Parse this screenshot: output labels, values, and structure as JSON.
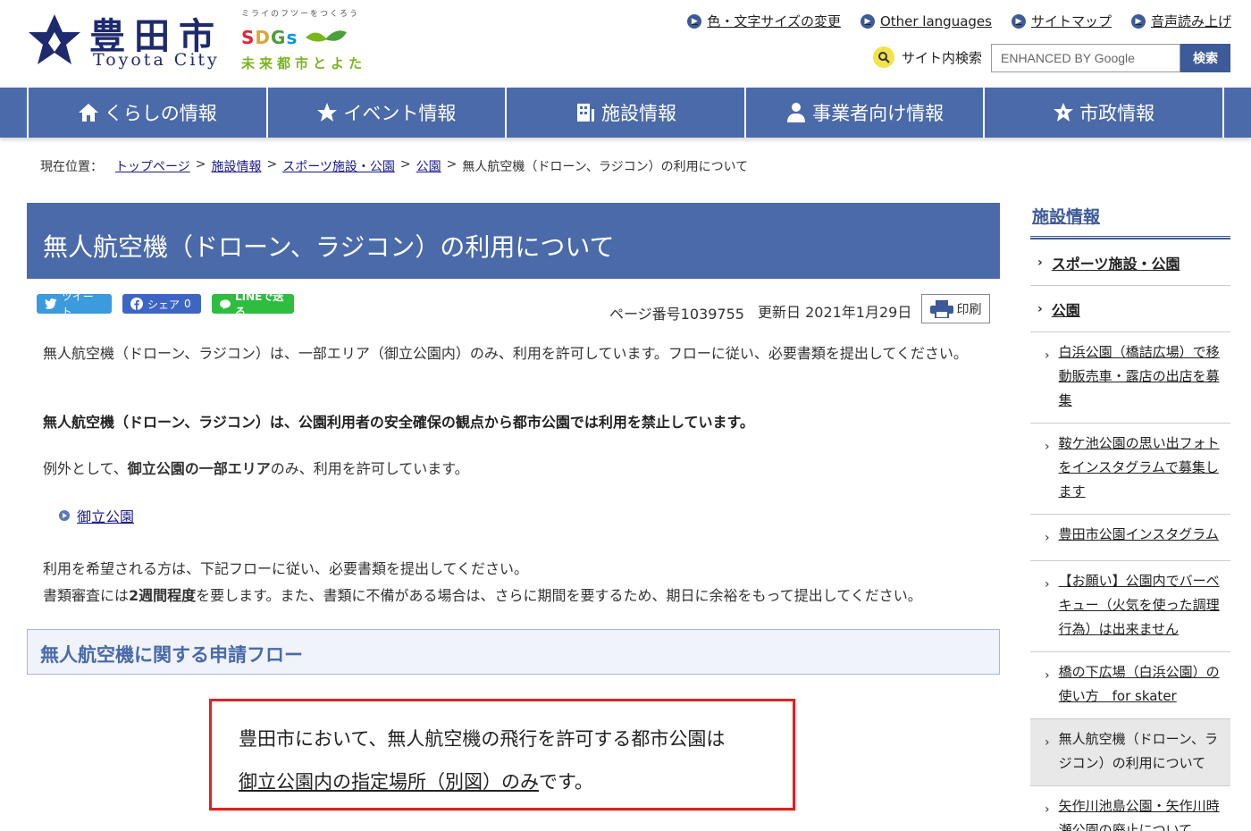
{
  "header": {
    "logo_kanji": "豊田市",
    "logo_roman": "Toyota City",
    "sdgs_tagline": "ミライのフツーをつくろう",
    "sdgs_letters": [
      "S",
      "D",
      "G",
      "s"
    ],
    "sdgs_city": "未来都市とよた",
    "util_links": [
      {
        "label": "色・文字サイズの変更"
      },
      {
        "label": "Other languages"
      },
      {
        "label": "サイトマップ"
      },
      {
        "label": "音声読み上げ"
      }
    ],
    "search_label": "サイト内検索",
    "search_placeholder": "ENHANCED BY Google",
    "search_button": "検索"
  },
  "nav": [
    {
      "label": "くらしの情報",
      "icon": "house-icon"
    },
    {
      "label": "イベント情報",
      "icon": "star-icon"
    },
    {
      "label": "施設情報",
      "icon": "building-icon"
    },
    {
      "label": "事業者向け情報",
      "icon": "person-icon"
    },
    {
      "label": "市政情報",
      "icon": "emblem-icon"
    }
  ],
  "breadcrumb": {
    "prefix": "現在位置：",
    "links": [
      "トップページ",
      "施設情報",
      "スポーツ施設・公園",
      "公園"
    ],
    "separator": ">",
    "current": "無人航空機（ドローン、ラジコン）の利用について"
  },
  "main": {
    "title": "無人航空機（ドローン、ラジコン）の利用について",
    "share": {
      "tweet": "ツイート",
      "facebook": "シェア",
      "facebook_count": "0",
      "line": "LINEで送る"
    },
    "page_number": "ページ番号1039755",
    "updated": "更新日 2021年1月29日",
    "print": "印刷",
    "p1": "無人航空機（ドローン、ラジコン）は、一部エリア（御立公園内）のみ、利用を許可しています。フローに従い、必要書類を提出してください。",
    "p2": "無人航空機（ドローン、ラジコン）は、公園利用者の安全確保の観点から都市公園では利用を禁止しています。",
    "p3_a": "例外として、",
    "p3_b": "御立公園の一部エリア",
    "p3_c": "のみ、利用を許可しています。",
    "link": "御立公園",
    "p4": "利用を希望される方は、下記フローに従い、必要書類を提出してください。",
    "p5_a": "書類審査には",
    "p5_b": "2週間程度",
    "p5_c": "を要します。また、書類に不備がある場合は、さらに期間を要するため、期日に余裕をもって提出してください。",
    "section_heading": "無人航空機に関する申請フロー",
    "notice_line1": "豊田市において、無人航空機の飛行を許可する都市公園は",
    "notice_line2_u": "御立公園内の指定場所（別図）のみ",
    "notice_line2_end": "です。"
  },
  "sidebar": {
    "title": "施設情報",
    "items": [
      {
        "label": "スポーツ施設・公園",
        "level": 1
      },
      {
        "label": "公園",
        "level": 1
      },
      {
        "label": "白浜公園（橋詰広場）で移動販売車・露店の出店を募集",
        "level": 2
      },
      {
        "label": "鞍ケ池公園の思い出フォトをインスタグラムで募集します",
        "level": 2
      },
      {
        "label": "豊田市公園インスタグラム",
        "level": 2
      },
      {
        "label": "【お願い】公園内でバーベキュー（火気を使った調理行為）は出来ません",
        "level": 2
      },
      {
        "label": "橋の下広場（白浜公園）の使い方　for skater",
        "level": 2
      },
      {
        "label": "無人航空機（ドローン、ラジコン）の利用について",
        "level": 2,
        "current": true
      },
      {
        "label": "矢作川池島公園・矢作川時瀬公園の廃止について",
        "level": 2
      }
    ]
  },
  "colors": {
    "brand_blue": "#4a6aaa",
    "notice_red": "#d22222"
  }
}
